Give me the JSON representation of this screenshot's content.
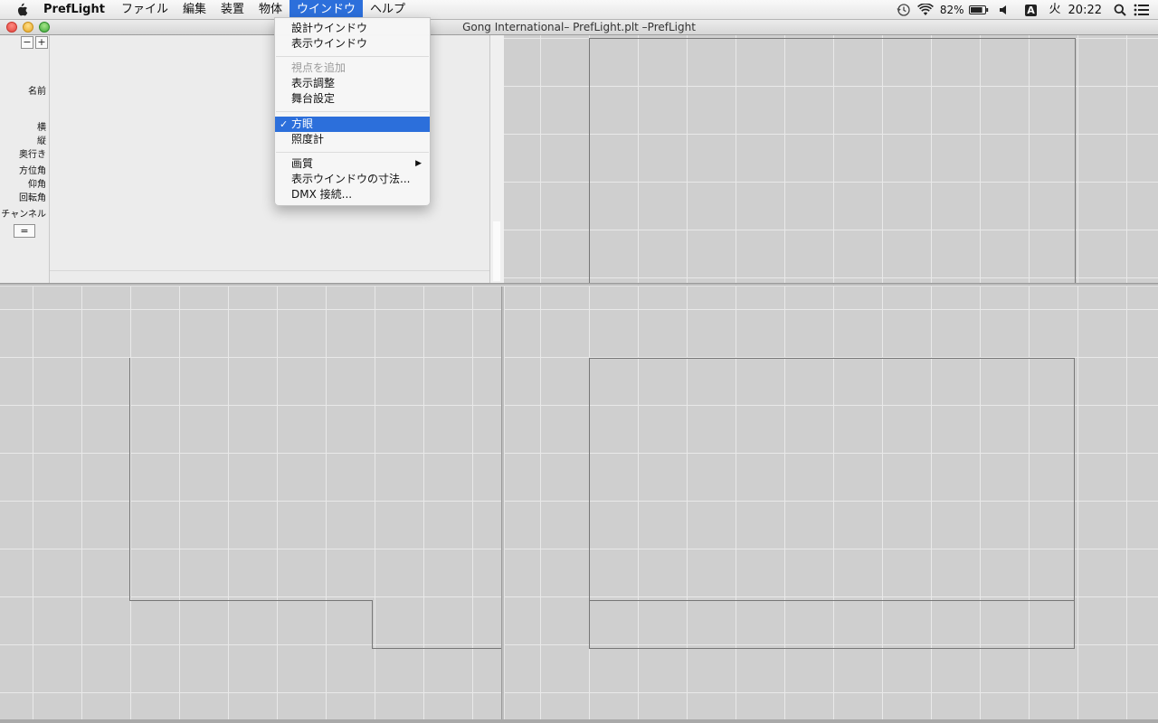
{
  "menubar": {
    "app_name": "PrefLight",
    "menus": [
      "ファイル",
      "編集",
      "装置",
      "物体",
      "ウインドウ",
      "ヘルプ"
    ],
    "active_menu": "ウインドウ",
    "status": {
      "battery": "82%",
      "day": "火",
      "time": "20:22",
      "input_source": "A"
    }
  },
  "window": {
    "title": "Gong International– PrefLight.plt –PrefLight"
  },
  "inspector": {
    "minus": "−",
    "plus": "+",
    "labels": {
      "name": "名前",
      "width": "横",
      "height": "縦",
      "depth": "奥行き",
      "azimuth": "方位角",
      "elevation": "仰角",
      "rotation": "回転角",
      "channel": "チャンネル"
    },
    "equal_button": "="
  },
  "window_menu": {
    "items": [
      {
        "label": "設計ウインドウ",
        "enabled": true
      },
      {
        "label": "表示ウインドウ",
        "enabled": true
      },
      {
        "label": "視点を追加",
        "enabled": false
      },
      {
        "label": "表示調整",
        "enabled": true
      },
      {
        "label": "舞台設定",
        "enabled": true
      },
      {
        "label": "方眼",
        "enabled": true,
        "checked": true,
        "selected": true
      },
      {
        "label": "照度計",
        "enabled": true
      },
      {
        "label": "画質",
        "enabled": true,
        "submenu": true
      },
      {
        "label": "表示ウインドウの寸法...",
        "enabled": true
      },
      {
        "label": "DMX 接続...",
        "enabled": true
      }
    ],
    "check_glyph": "✓",
    "submenu_glyph": "▶"
  },
  "colors": {
    "accent": "#2c6fdb",
    "grid_background": "#cfcfcf",
    "grid_line": "#e9e9e9",
    "stage_outline": "#777777"
  },
  "icons": [
    "apple-icon",
    "time-machine-icon",
    "wifi-icon",
    "battery-icon",
    "volume-icon",
    "input-source-icon",
    "spotlight-search-icon",
    "notification-center-icon"
  ]
}
